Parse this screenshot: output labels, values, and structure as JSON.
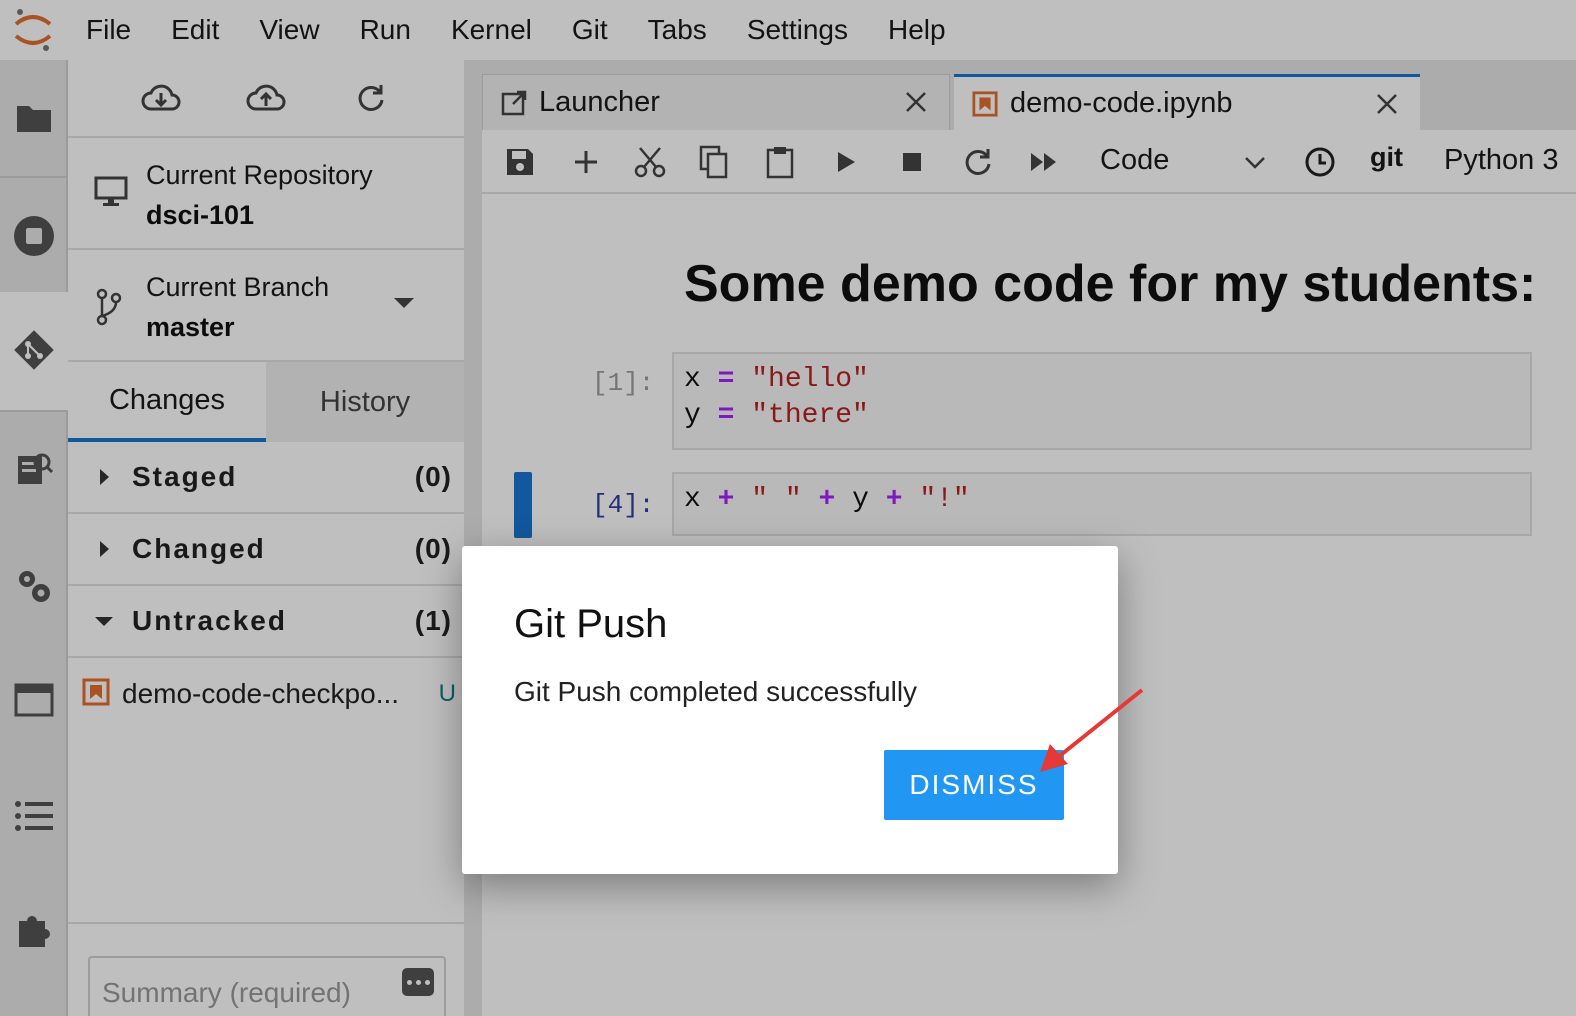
{
  "menu": {
    "items": [
      "File",
      "Edit",
      "View",
      "Run",
      "Kernel",
      "Git",
      "Tabs",
      "Settings",
      "Help"
    ]
  },
  "activity_bar": {
    "icons": [
      "folder-icon",
      "stop-circle-icon",
      "git-icon",
      "property-inspector-icon",
      "settings-gears-icon",
      "window-icon",
      "table-of-contents-icon",
      "extension-puzzle-icon"
    ],
    "active": "git-icon"
  },
  "git_panel": {
    "toolbar": [
      "cloud-pull-icon",
      "cloud-push-icon",
      "refresh-icon"
    ],
    "repository_label": "Current Repository",
    "repository_name": "dsci-101",
    "branch_label": "Current Branch",
    "branch_name": "master",
    "tabs": [
      "Changes",
      "History"
    ],
    "active_tab": "Changes",
    "sections": [
      {
        "name": "Staged",
        "count": "(0)",
        "expanded": false
      },
      {
        "name": "Changed",
        "count": "(0)",
        "expanded": false
      },
      {
        "name": "Untracked",
        "count": "(1)",
        "expanded": true
      }
    ],
    "untracked_files": [
      {
        "name": "demo-code-checkpo...",
        "status": "U"
      }
    ],
    "summary_placeholder": "Summary (required)"
  },
  "main": {
    "tabs": [
      {
        "label": "Launcher",
        "icon": "launcher-icon",
        "active": false
      },
      {
        "label": "demo-code.ipynb",
        "icon": "notebook-icon",
        "active": true
      }
    ],
    "toolbar": {
      "icons": [
        "save-icon",
        "add-icon",
        "cut-icon",
        "copy-icon",
        "paste-icon",
        "run-icon",
        "stop-icon",
        "restart-icon",
        "fast-forward-icon"
      ],
      "cell_type": "Code",
      "git_label": "git",
      "kernel": "Python 3"
    },
    "notebook": {
      "title": "Some demo code for my students:",
      "cells": [
        {
          "prompt": "[1]:",
          "lines": [
            "x = \"hello\"",
            "y = \"there\""
          ],
          "active": false
        },
        {
          "prompt": "[4]:",
          "lines": [
            "x + \" \" + y + \"!\""
          ],
          "active": true
        }
      ]
    }
  },
  "dialog": {
    "title": "Git Push",
    "message": "Git Push completed successfully",
    "button": "DISMISS"
  },
  "colors": {
    "accent": "#2196f3",
    "tab_accent": "#1976d2",
    "annotation_arrow": "#e53935",
    "notebook_icon": "#e46e2e"
  }
}
